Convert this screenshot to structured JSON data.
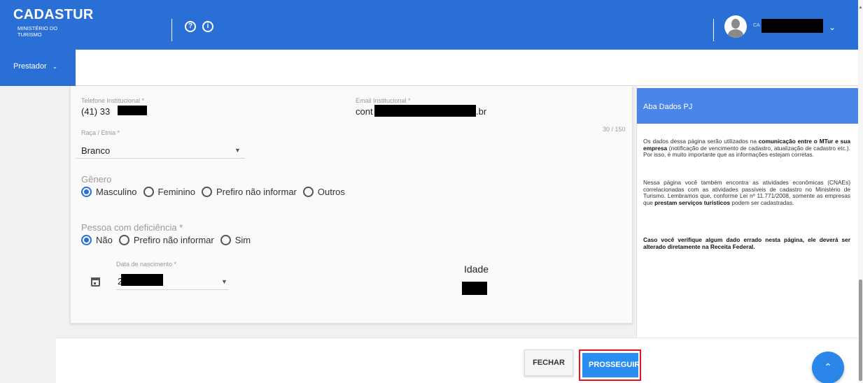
{
  "header": {
    "brand": "CADASTUR",
    "brand_sub": "MINISTÉRIO DO TURISMO",
    "help_icon": "help-circle-icon",
    "info_icon": "info-circle-icon",
    "user_prefix": "CA",
    "user_chevron": "chevron-down-icon",
    "accent_color": "#2a6fd6"
  },
  "nav": {
    "prestador_label": "Prestador",
    "chevron": "⌄"
  },
  "form": {
    "telefone_label": "Telefone Institucional *",
    "telefone_value": "(41) 33",
    "email_label": "Email Institucional *",
    "email_value_prefix": "cont",
    "email_value_suffix": ".br",
    "email_counter": "30 / 150",
    "raca_label": "Raça / Etnia *",
    "raca_value": "Branco",
    "genero_label": "Gênero",
    "genero_options": [
      "Masculino",
      "Feminino",
      "Prefiro não informar",
      "Outros"
    ],
    "genero_selected": "Masculino",
    "deficiencia_label": "Pessoa com deficiência *",
    "deficiencia_options": [
      "Não",
      "Prefiro não informar",
      "Sim"
    ],
    "deficiencia_selected": "Não",
    "nascimento_label": "Data de nascimento *",
    "nascimento_value_prefix": "2",
    "idade_label": "Idade"
  },
  "help": {
    "title": "Aba Dados PJ",
    "p1_a": "Os dados dessa página serão utilizados na ",
    "p1_b": "comunicação entre o MTur e sua empresa",
    "p1_c": " (notificação de vencimento de cadastro, atualização de cadastro etc.). Por isso, é muito importante que as informações estejam corretas.",
    "p2_a": "Nessa página você também encontra as atividades econômicas (CNAEs) correlacionadas com as atividades passíveis de cadastro no Ministério de Turismo. Lembramos que, conforme Lei nº 11.771/2008, somente as empresas que ",
    "p2_b": "prestam serviços turísticos",
    "p2_c": " podem ser cadastradas.",
    "p3": "Caso você verifique algum dado errado nesta página, ele deverá ser alterado diretamente na Receita Federal."
  },
  "footer": {
    "fechar_label": "FECHAR",
    "prosseguir_label": "PROSSEGUIR",
    "fab_icon": "chevron-up-icon"
  }
}
